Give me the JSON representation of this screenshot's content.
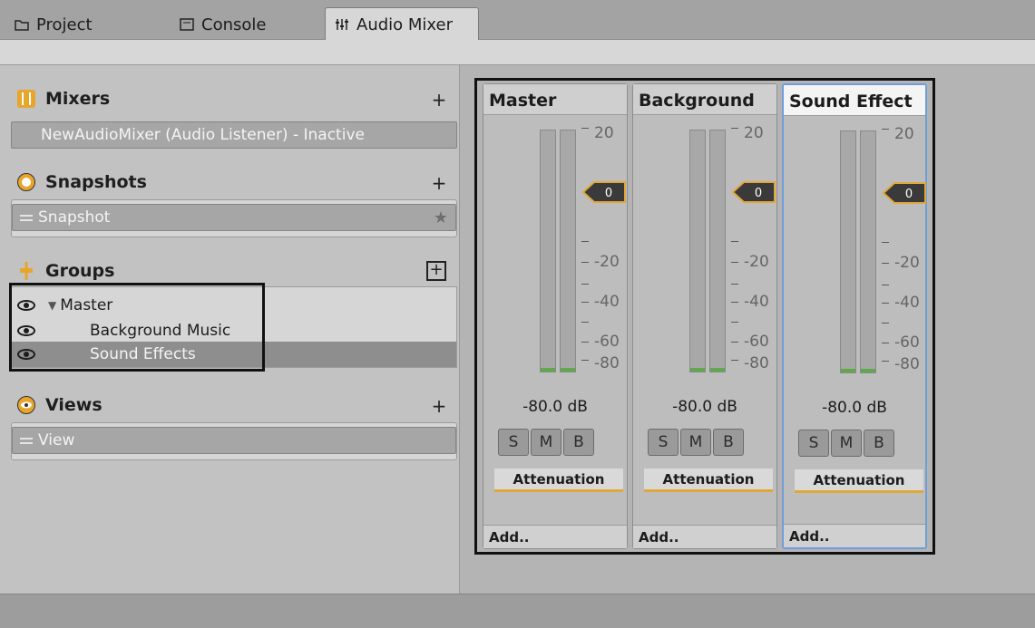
{
  "tabs": [
    {
      "label": "Project",
      "icon": "folder-icon"
    },
    {
      "label": "Console",
      "icon": "console-icon"
    },
    {
      "label": "Audio Mixer",
      "icon": "mixer-icon",
      "active": true
    }
  ],
  "sidebar": {
    "mixers": {
      "title": "Mixers",
      "add": "+",
      "items": [
        {
          "label": "NewAudioMixer  (Audio Listener) - Inactive"
        }
      ]
    },
    "snapshots": {
      "title": "Snapshots",
      "add": "+",
      "items": [
        {
          "label": "Snapshot",
          "star": "★"
        }
      ]
    },
    "groups": {
      "title": "Groups",
      "add": "+",
      "items": [
        {
          "label": "Master",
          "expanded": true,
          "arrow": "▼"
        },
        {
          "label": "Background Music"
        },
        {
          "label": "Sound Effects",
          "selected": true
        }
      ]
    },
    "views": {
      "title": "Views",
      "add": "+",
      "items": [
        {
          "label": "View"
        }
      ]
    }
  },
  "strips": [
    {
      "name": "Master",
      "level": "-80.0 dB",
      "attenuation_value": "0",
      "buttons": [
        "S",
        "M",
        "B"
      ],
      "effect": "Attenuation",
      "add": "Add..",
      "active": false
    },
    {
      "name": "Background",
      "level": "-80.0 dB",
      "attenuation_value": "0",
      "buttons": [
        "S",
        "M",
        "B"
      ],
      "effect": "Attenuation",
      "add": "Add..",
      "active": false
    },
    {
      "name": "Sound Effect",
      "level": "-80.0 dB",
      "attenuation_value": "0",
      "buttons": [
        "S",
        "M",
        "B"
      ],
      "effect": "Attenuation",
      "add": "Add..",
      "active": true
    }
  ],
  "scale_labels": [
    "20",
    "-20",
    "-40",
    "-60",
    "-80"
  ],
  "colors": {
    "accent": "#e0a83a",
    "meter_green": "#5fa84e",
    "selection_blue": "#6f9ed6"
  }
}
